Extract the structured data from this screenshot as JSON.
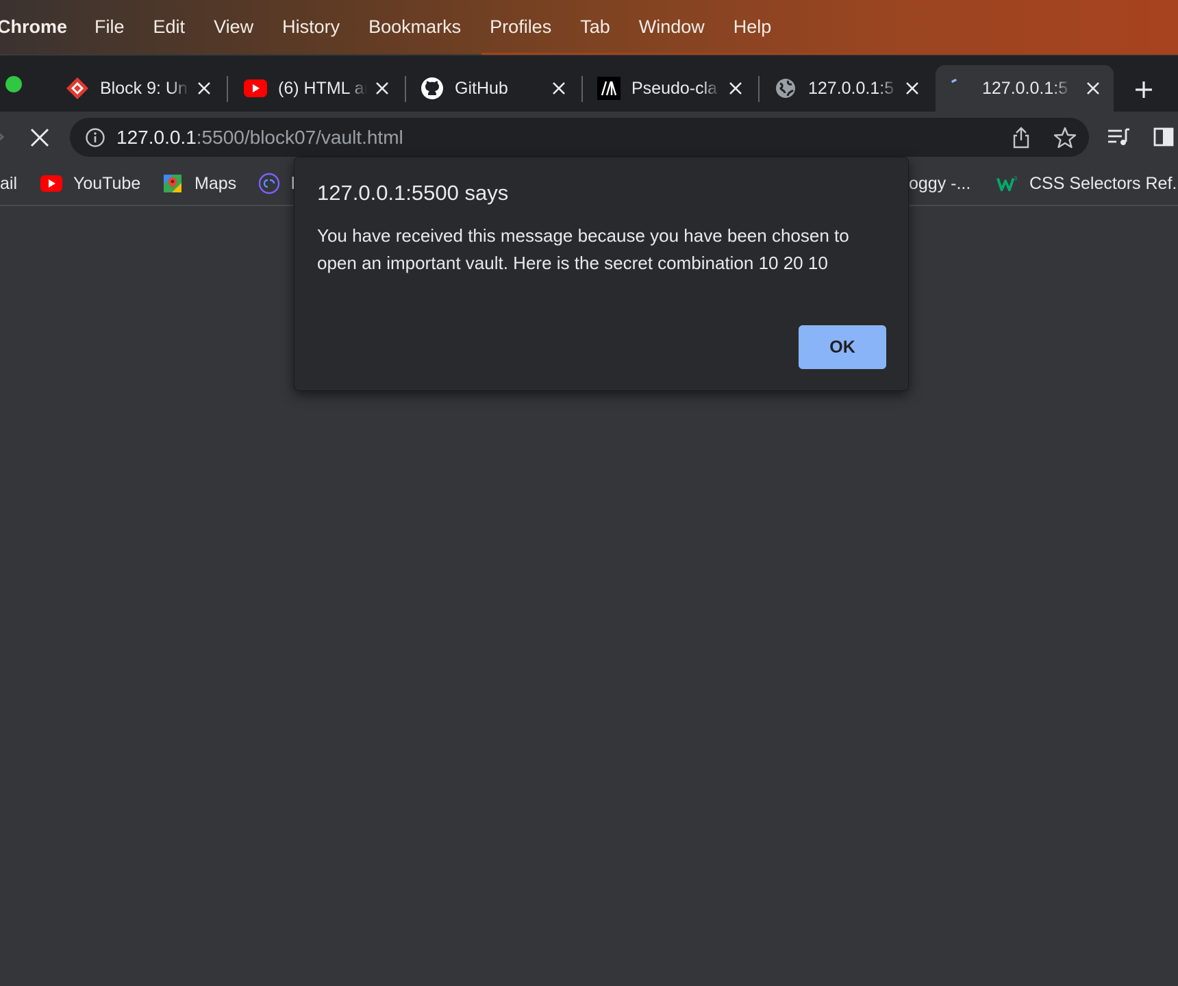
{
  "menubar": {
    "app_name": "Chrome",
    "items": [
      "File",
      "Edit",
      "View",
      "History",
      "Bookmarks",
      "Profiles",
      "Tab",
      "Window",
      "Help"
    ]
  },
  "tabs": [
    {
      "title": "Block 9: Un",
      "icon": "block-logo-icon",
      "active": false
    },
    {
      "title": "(6) HTML ar",
      "icon": "youtube-icon",
      "active": false
    },
    {
      "title": "GitHub",
      "icon": "github-icon",
      "active": false
    },
    {
      "title": "Pseudo-cla",
      "icon": "mdn-icon",
      "active": false
    },
    {
      "title": "127.0.0.1:5",
      "icon": "globe-icon",
      "active": false
    },
    {
      "title": "127.0.0.1:5",
      "icon": "loading-spinner-icon",
      "active": true
    }
  ],
  "toolbar": {
    "url_host": "127.0.0.1",
    "url_path": ":5500/block07/vault.html"
  },
  "bookmarks": [
    {
      "label": "ail",
      "icon": ""
    },
    {
      "label": "YouTube",
      "icon": "youtube-icon"
    },
    {
      "label": "Maps",
      "icon": "maps-icon"
    },
    {
      "label": "l",
      "icon": "codecademy-icon"
    },
    {
      "label": "oggy -...",
      "icon": ""
    },
    {
      "label": "CSS Selectors Ref...",
      "icon": "w3schools-icon"
    }
  ],
  "dialog": {
    "title": "127.0.0.1:5500 says",
    "message": "You have received this message because you have been chosen to open an important vault. Here is the secret combination 10 20 10",
    "ok_label": "OK"
  },
  "colors": {
    "page_background": "#35363a",
    "tabstrip": "#202124",
    "dialog_background": "#292a2d",
    "ok_button": "#8ab4f8"
  }
}
